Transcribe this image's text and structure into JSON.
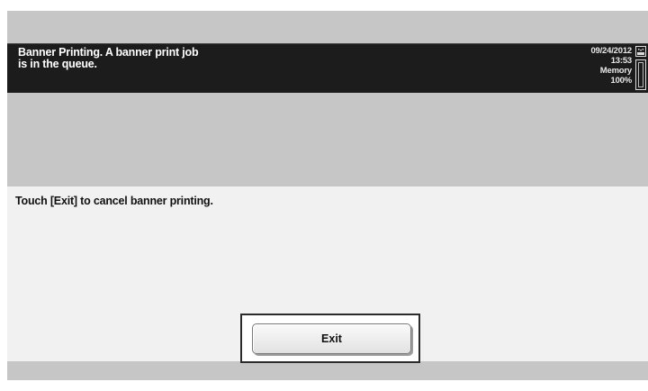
{
  "status": {
    "message_line1": "Banner Printing. A banner print job",
    "message_line2": "is in the queue.",
    "date": "09/24/2012",
    "time": "13:53",
    "memory_label": "Memory",
    "memory_value": "100%",
    "memory_fraction": 1.0,
    "memory_icon": "memory-indicator-icon"
  },
  "panel": {
    "message": "Touch [Exit] to cancel banner printing.",
    "exit_label": "Exit"
  },
  "colors": {
    "screen_background": "#c6c6c6",
    "status_bar": "#1c1c1c",
    "panel_background": "#f1f1f1"
  }
}
